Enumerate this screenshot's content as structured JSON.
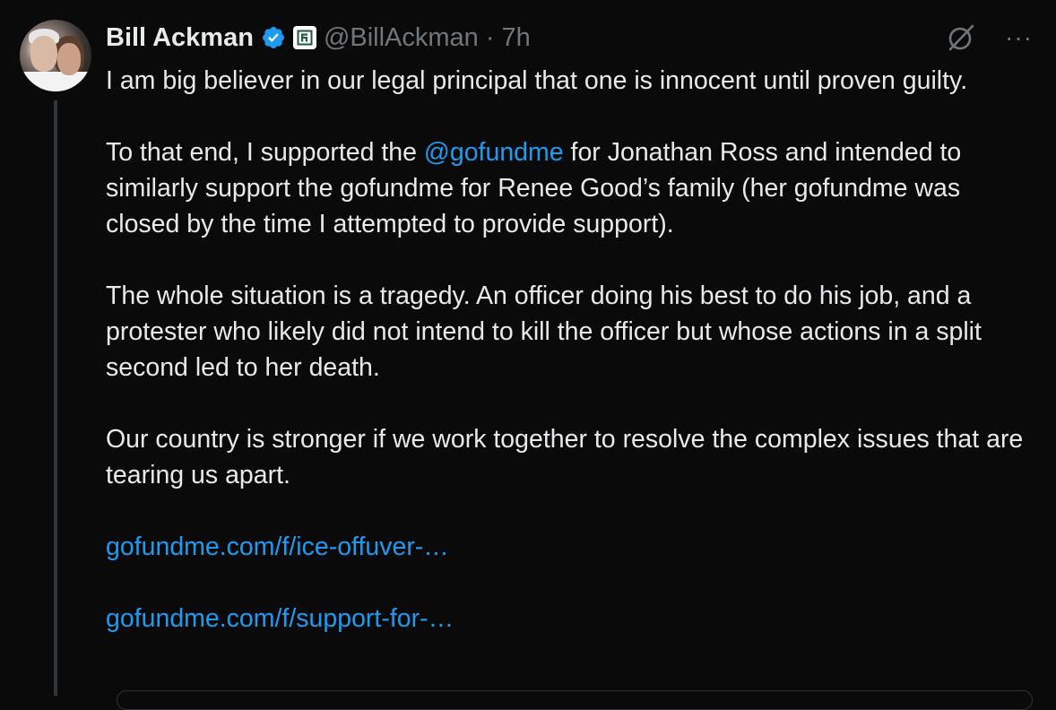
{
  "tweet": {
    "author_name": "Bill Ackman",
    "handle": "@BillAckman",
    "separator": "·",
    "time": "7h",
    "paragraph1": "I am big believer in our legal principal that one is innocent until proven guilty.",
    "paragraph2_before": "To that end, I supported the ",
    "mention": "@gofundme",
    "paragraph2_after": " for Jonathan Ross and intended to similarly support the gofundme for Renee Good’s family (her gofundme was closed by the time I attempted to provide support).",
    "paragraph3": "The whole situation is a tragedy. An officer doing his best to do his job, and a protester who likely did not intend to kill the officer but whose actions in a split second led to her death.",
    "paragraph4": "Our country is stronger if we work together to resolve the complex issues that are tearing us apart.",
    "link1": "gofundme.com/f/ice-offuver-…",
    "link2": "gofundme.com/f/support-for-…",
    "more_label": "···"
  },
  "icons": {
    "verified": "verified-badge-icon",
    "affiliate": "affiliate-badge-icon",
    "grok": "grok-icon",
    "more": "more-icon"
  },
  "colors": {
    "background": "#0a0a0b",
    "text": "#e7e9ea",
    "muted": "#71767b",
    "link": "#1d9bf0"
  }
}
